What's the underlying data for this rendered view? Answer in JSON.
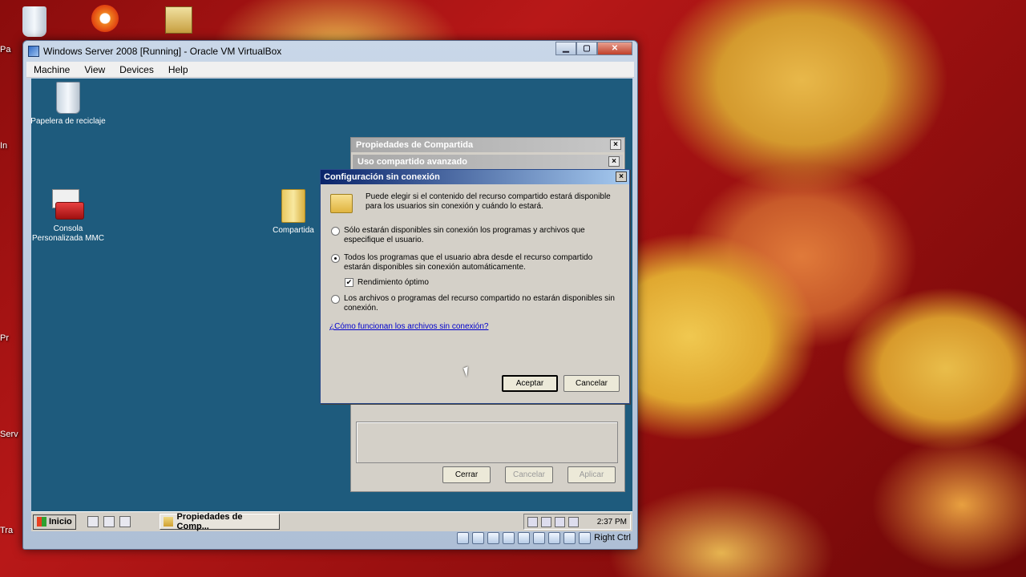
{
  "host_desktop": {
    "edge_labels": [
      "Pa",
      "In",
      "Pr",
      "Serv",
      "Tra"
    ]
  },
  "vbox": {
    "title": "Windows Server 2008 [Running] - Oracle VM VirtualBox",
    "menu": [
      "Machine",
      "View",
      "Devices",
      "Help"
    ],
    "status_host_key": "Right Ctrl"
  },
  "guest_desktop": {
    "icons": [
      {
        "label": "Papelera de reciclaje"
      },
      {
        "label": "Consola Personalizada MMC"
      },
      {
        "label": "Compartida"
      }
    ]
  },
  "properties_dialog": {
    "title": "Propiedades de Compartida",
    "subtitle": "Uso compartido avanzado",
    "close": "×",
    "buttons": {
      "close": "Cerrar",
      "cancel": "Cancelar",
      "apply": "Aplicar"
    }
  },
  "offline_dialog": {
    "title": "Configuración sin conexión",
    "close": "×",
    "intro": "Puede elegir si el contenido del recurso compartido estará disponible para los usuarios sin conexión y cuándo lo estará.",
    "options": [
      {
        "label": "Sólo estarán disponibles sin conexión los programas y archivos que especifique el usuario.",
        "selected": false
      },
      {
        "label": "Todos los programas que el usuario abra desde el recurso compartido estarán disponibles sin conexión automáticamente.",
        "selected": true
      },
      {
        "label": "Los archivos o programas del recurso compartido no estarán disponibles sin conexión.",
        "selected": false
      }
    ],
    "optimize_label": "Rendimiento óptimo",
    "optimize_checked": true,
    "help_link": "¿Cómo funcionan los archivos sin conexión?",
    "ok": "Aceptar",
    "cancel": "Cancelar"
  },
  "guest_taskbar": {
    "start": "Inicio",
    "task_item": "Propiedades de Comp...",
    "clock": "2:37 PM"
  }
}
